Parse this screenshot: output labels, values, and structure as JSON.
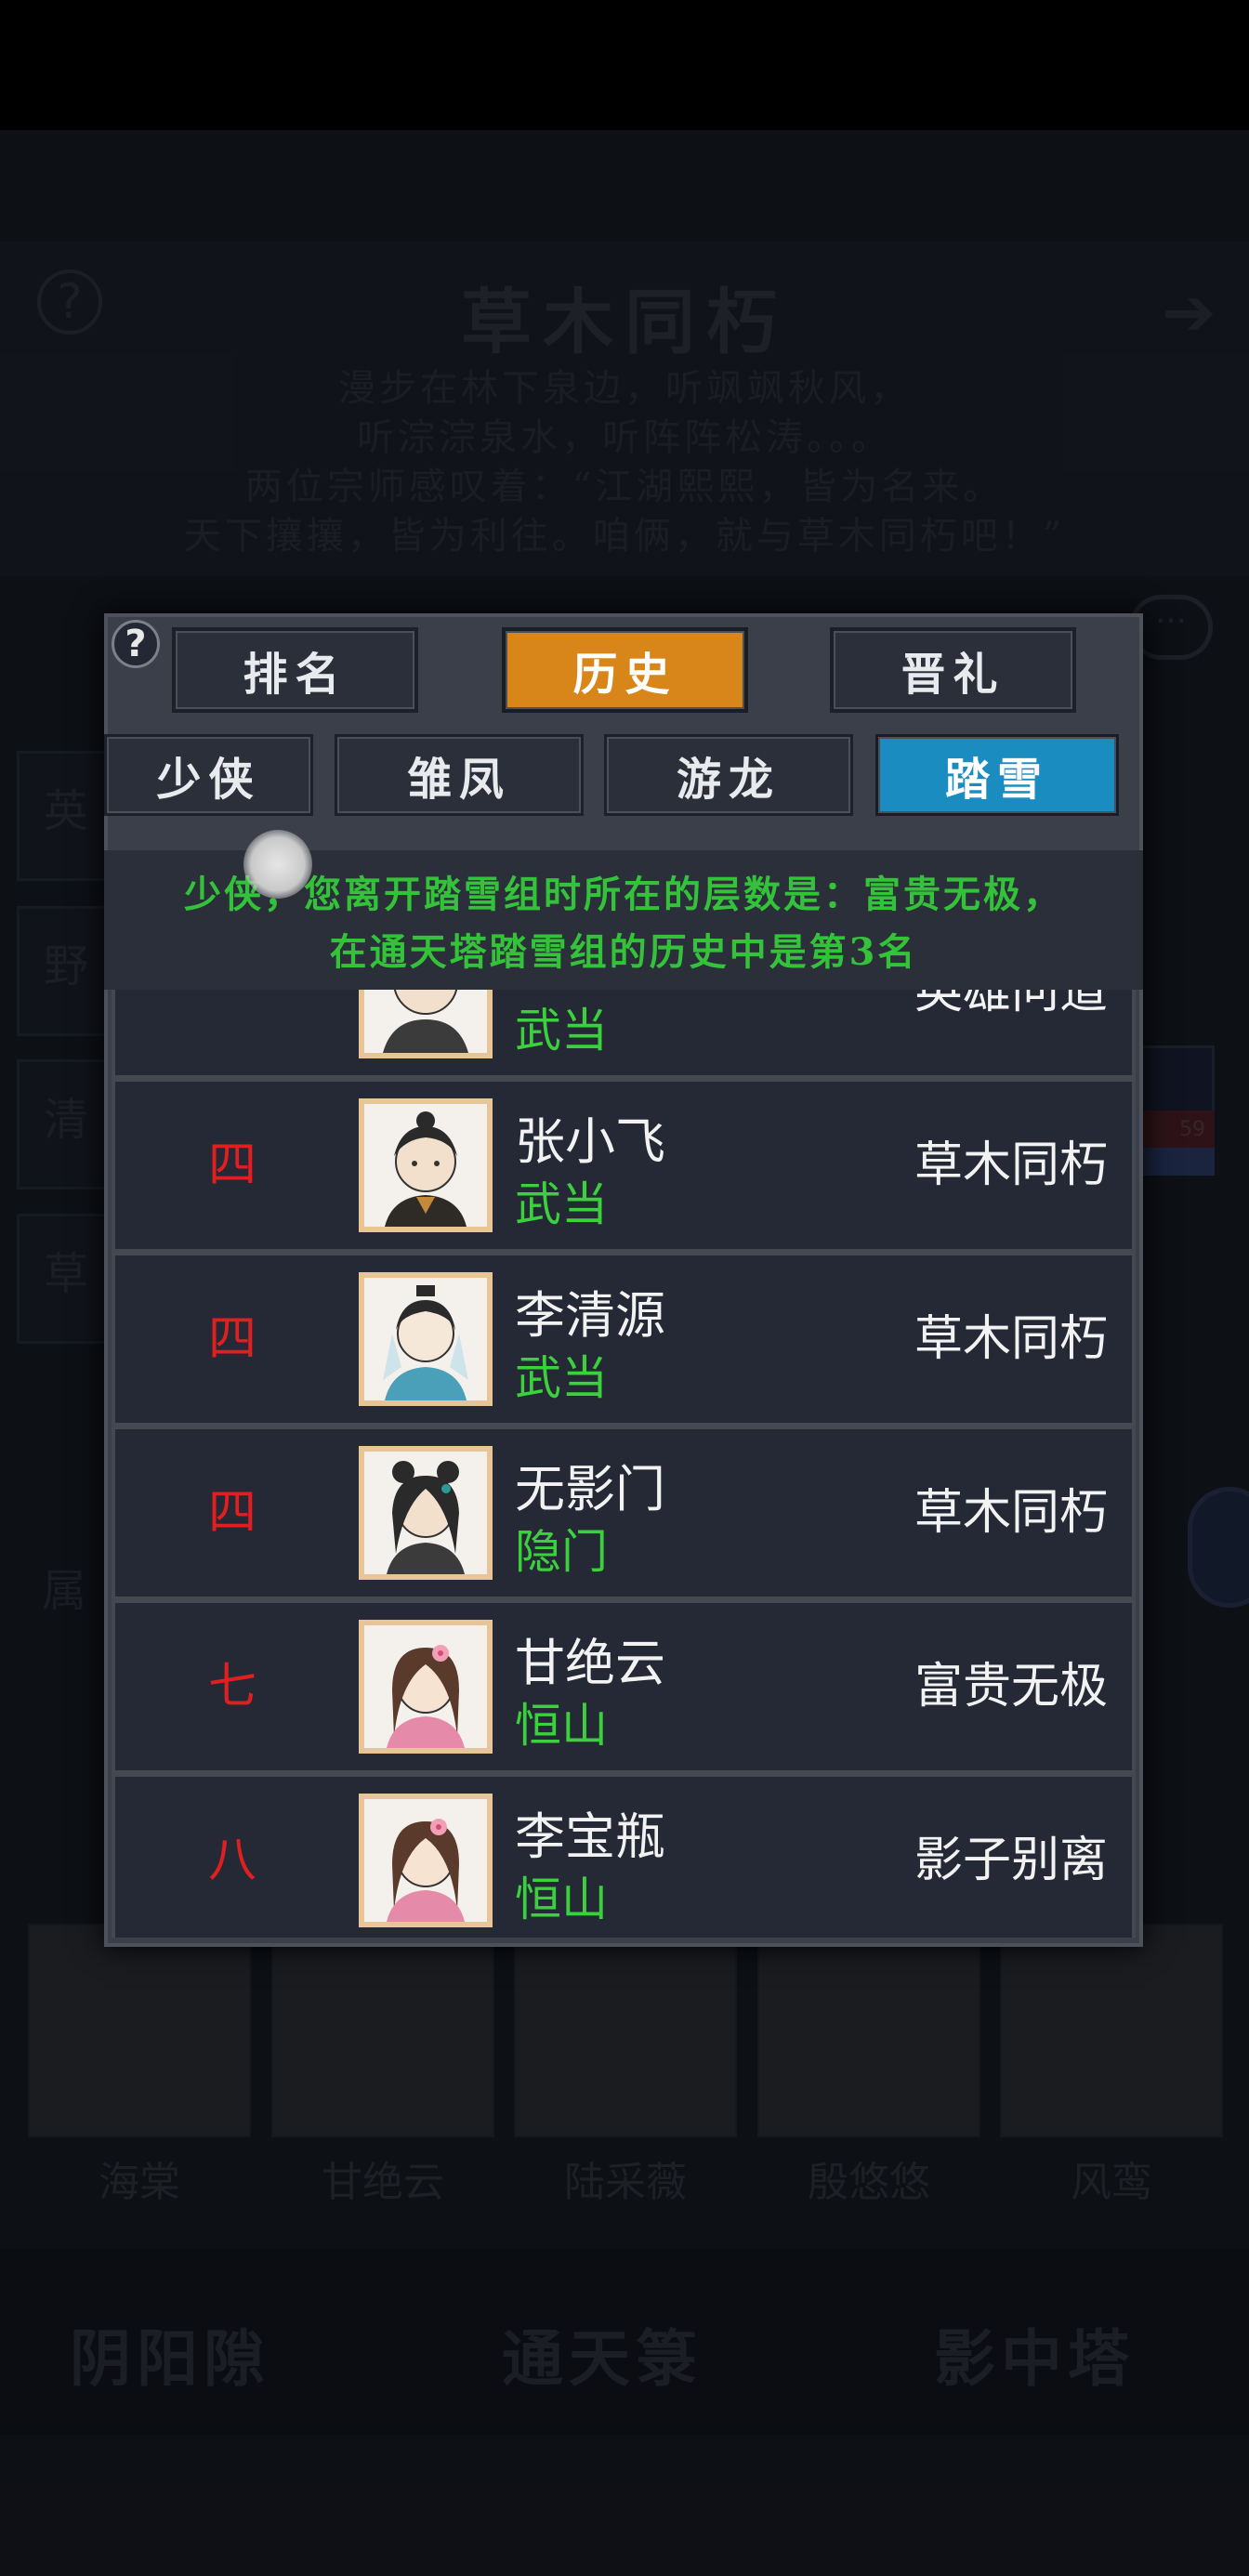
{
  "background": {
    "title": "草木同朽",
    "poem": [
      "漫步在林下泉边，听飒飒秋风，",
      "听淙淙泉水，听阵阵松涛。。。",
      "两位宗师感叹着：“江湖熙熙，皆为名来。",
      "天下攘攘，皆为利往。咱俩，就与草木同朽吧！”"
    ],
    "side_tabs": [
      "英",
      "野",
      "清",
      "草"
    ],
    "attr_label": "属",
    "portraits": [
      "海棠",
      "甘绝云",
      "陆采薇",
      "殷悠悠",
      "风鸾"
    ],
    "bottom_buttons": [
      "阴阳隙",
      "通天箓",
      "影中塔"
    ],
    "right_badge": "59"
  },
  "modal": {
    "help": "?",
    "tabs": [
      "排名",
      "历史",
      "晋礼"
    ],
    "active_tab": "历史",
    "subtabs": [
      "少侠",
      "雏凤",
      "游龙",
      "踏雪"
    ],
    "active_subtab": "踏雪",
    "message": [
      "少侠，您离开踏雪组时所在的层数是：富贵无极，",
      "在通天塔踏雪组的历史中是第3名"
    ],
    "rows": [
      {
        "rank": "",
        "name": "",
        "sect": "武当",
        "title": "英雄问道"
      },
      {
        "rank": "四",
        "name": "张小飞",
        "sect": "武当",
        "title": "草木同朽"
      },
      {
        "rank": "四",
        "name": "李清源",
        "sect": "武当",
        "title": "草木同朽"
      },
      {
        "rank": "四",
        "name": "无影门",
        "sect": "隐门",
        "title": "草木同朽"
      },
      {
        "rank": "七",
        "name": "甘绝云",
        "sect": "恒山",
        "title": "富贵无极"
      },
      {
        "rank": "八",
        "name": "李宝瓶",
        "sect": "恒山",
        "title": "影子别离"
      }
    ]
  },
  "colors": {
    "active_tab": "#d88519",
    "active_subtab": "#1a8cc0",
    "rank": "#e02020",
    "sect": "#3bd13d",
    "message": "#34c23a"
  }
}
